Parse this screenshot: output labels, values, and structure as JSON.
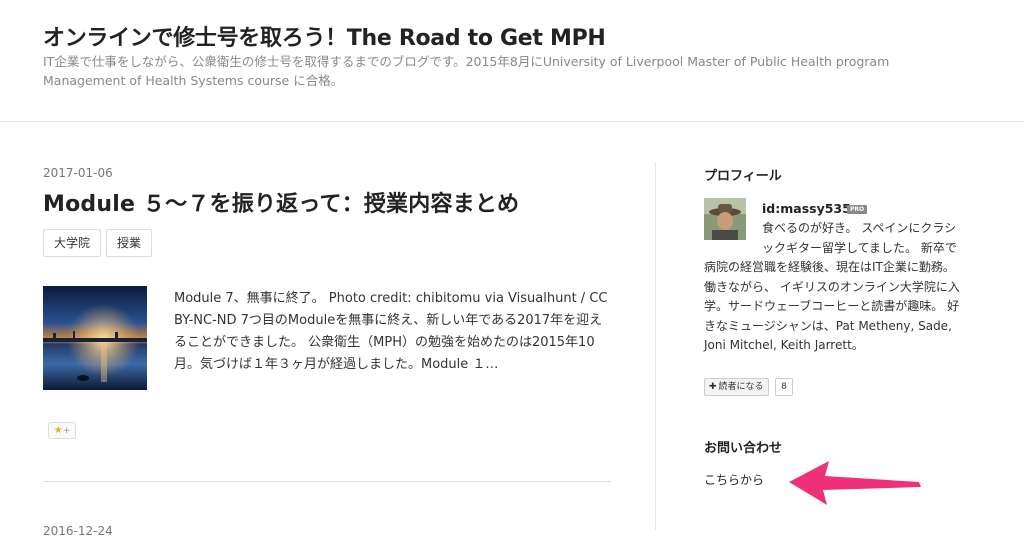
{
  "blog": {
    "title": "オンラインで修士号を取ろう！The Road to Get MPH",
    "description": "IT企業で仕事をしながら、公衆衛生の修士号を取得するまでのブログです。2015年8月にUniversity of Liverpool Master of Public Health program Management of Health Systems course に合格。"
  },
  "entry": {
    "date": "2017-01-06",
    "title": "Module ５〜７を振り返って：授業内容まとめ",
    "categories": [
      "大学院",
      "授業"
    ],
    "summary": "Module 7、無事に終了。 Photo credit: chibitomu via Visualhunt / CC BY-NC-ND 7つ目のModuleを無事に終え、新しい年である2017年を迎えることができました。 公衆衛生（MPH）の勉強を始めたのは2015年10月。気づけば１年３ヶ月が経過しました。Module １…",
    "star_label": "+"
  },
  "next_entry": {
    "date": "2016-12-24"
  },
  "sidebar": {
    "profile": {
      "heading": "プロフィール",
      "id": "id:massy535",
      "badge": "PRO",
      "text": "食べるのが好き。 スペインにクラシックギター留学してました。 新卒で病院の経営職を経験後、現在はIT企業に勤務。 働きながら、 イギリスのオンライン大学院に入学。サードウェーブコーヒーと読書が趣味。 好きなミュージシャンは、Pat Metheny, Sade, Joni Mitchel, Keith Jarrett。",
      "reader_button": "読者になる",
      "reader_count": "8"
    },
    "contact": {
      "heading": "お問い合わせ",
      "link": "こちらから"
    }
  },
  "colors": {
    "arrow": "#f0307a",
    "star": "#f5a623"
  }
}
